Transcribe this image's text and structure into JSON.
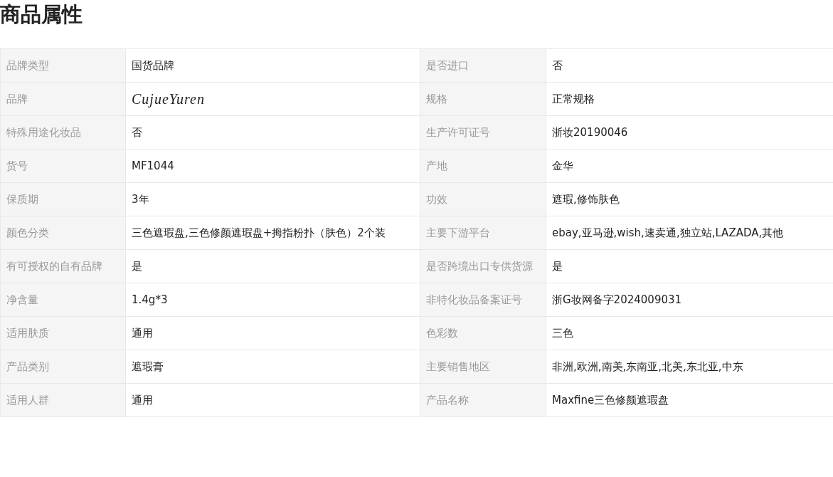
{
  "title": "商品属性",
  "table": {
    "rows": [
      {
        "pairs": [
          {
            "label": "品牌类型",
            "value": "国货品牌",
            "kind": "text"
          },
          {
            "label": "是否进口",
            "value": "否",
            "kind": "text"
          }
        ]
      },
      {
        "pairs": [
          {
            "label": "品牌",
            "value": "CujueYuren",
            "kind": "script"
          },
          {
            "label": "规格",
            "value": "正常规格",
            "kind": "text"
          }
        ]
      },
      {
        "pairs": [
          {
            "label": "特殊用途化妆品",
            "value": "否",
            "kind": "text"
          },
          {
            "label": "生产许可证号",
            "value": "浙妆20190046",
            "kind": "text"
          }
        ]
      },
      {
        "pairs": [
          {
            "label": "货号",
            "value": "MF1044",
            "kind": "text"
          },
          {
            "label": "产地",
            "value": "金华",
            "kind": "text"
          }
        ]
      },
      {
        "pairs": [
          {
            "label": "保质期",
            "value": "3年",
            "kind": "text"
          },
          {
            "label": "功效",
            "value": "遮瑕,修饰肤色",
            "kind": "text"
          }
        ]
      },
      {
        "pairs": [
          {
            "label": "颜色分类",
            "value": "三色遮瑕盘,三色修颜遮瑕盘+拇指粉扑（肤色）2个装",
            "kind": "text"
          },
          {
            "label": "主要下游平台",
            "value": "ebay,亚马逊,wish,速卖通,独立站,LAZADA,其他",
            "kind": "text"
          }
        ]
      },
      {
        "pairs": [
          {
            "label": "有可授权的自有品牌",
            "value": "是",
            "kind": "text"
          },
          {
            "label": "是否跨境出口专供货源",
            "value": "是",
            "kind": "text"
          }
        ]
      },
      {
        "pairs": [
          {
            "label": "净含量",
            "value": "1.4g*3",
            "kind": "text"
          },
          {
            "label": "非特化妆品备案证号",
            "value": "浙G妆网备字2024009031",
            "kind": "text"
          }
        ]
      },
      {
        "pairs": [
          {
            "label": "适用肤质",
            "value": "通用",
            "kind": "text"
          },
          {
            "label": "色彩数",
            "value": "三色",
            "kind": "text"
          }
        ]
      },
      {
        "pairs": [
          {
            "label": "产品类别",
            "value": "遮瑕膏",
            "kind": "text"
          },
          {
            "label": "主要销售地区",
            "value": "非洲,欧洲,南美,东南亚,北美,东北亚,中东",
            "kind": "text"
          }
        ]
      },
      {
        "pairs": [
          {
            "label": "适用人群",
            "value": "通用",
            "kind": "text"
          },
          {
            "label": "产品名称",
            "value": "Maxfine三色修颜遮瑕盘",
            "kind": "text"
          }
        ]
      }
    ]
  }
}
